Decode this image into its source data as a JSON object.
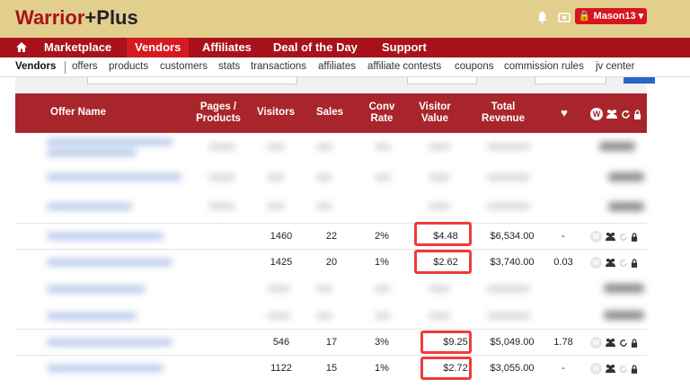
{
  "header": {
    "logo_main": "Warrior",
    "logo_plus": "+Plus",
    "user_label": "🔒 Mason13 ▾"
  },
  "nav": {
    "home_icon": "⌂",
    "items": [
      "Marketplace",
      "Vendors",
      "Affiliates",
      "Deal of the Day",
      "Support"
    ]
  },
  "subnav": {
    "items": [
      "Vendors",
      "offers",
      "products",
      "customers",
      "stats",
      "transactions",
      "affiliates",
      "affiliate contests",
      "coupons",
      "commission rules",
      "jv center"
    ]
  },
  "table": {
    "headers": {
      "offer_name": "Offer Name",
      "pages_products": "Pages / Products",
      "visitors": "Visitors",
      "sales": "Sales",
      "conv_rate": "Conv Rate",
      "visitor_value": "Visitor Value",
      "total_revenue": "Total Revenue",
      "heart": "♥",
      "w": "W"
    },
    "rows": [
      {
        "visitors": "1460",
        "sales": "22",
        "conv": "2%",
        "value": "$4.48",
        "revenue": "$6,534.00",
        "epc": "-"
      },
      {
        "visitors": "1425",
        "sales": "20",
        "conv": "1%",
        "value": "$2.62",
        "revenue": "$3,740.00",
        "epc": "0.03"
      },
      {
        "visitors": "546",
        "sales": "17",
        "conv": "3%",
        "value": "$9.25",
        "revenue": "$5,049.00",
        "epc": "1.78"
      },
      {
        "visitors": "1122",
        "sales": "15",
        "conv": "1%",
        "value": "$2.72",
        "revenue": "$3,055.00",
        "epc": "-"
      }
    ],
    "row_w": "W"
  },
  "colors": {
    "header_bg": "#e2cf8e",
    "brand_red": "#a8121b",
    "highlight": "#ef3b3b"
  }
}
